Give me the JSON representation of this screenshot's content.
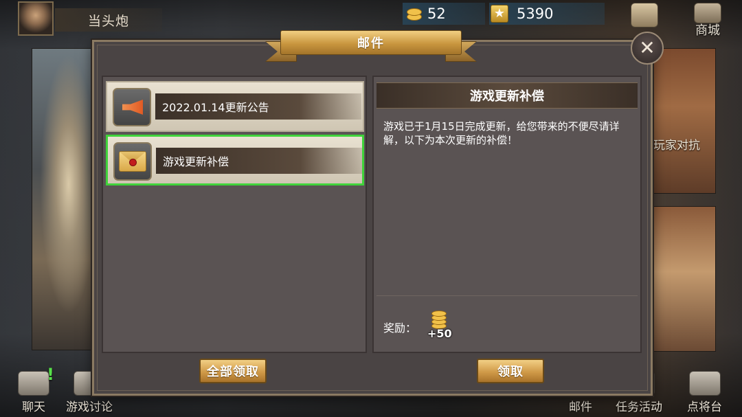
{
  "player": {
    "name": "当头炮"
  },
  "currency": {
    "gold": "52",
    "stars": "5390"
  },
  "top_nav": {
    "shop_label": "商城"
  },
  "background": {
    "right_card_label": "玩家对抗"
  },
  "dialog": {
    "title": "邮件",
    "close_symbol": "✕",
    "mails": [
      {
        "subject": "2022.01.14更新公告",
        "icon": "speaker-icon"
      },
      {
        "subject": "游戏更新补偿",
        "icon": "envelope-icon"
      }
    ],
    "detail": {
      "title": "游戏更新补偿",
      "body": "游戏已于1月15日完成更新，给您带来的不便尽请详解，以下为本次更新的补偿！",
      "reward_label": "奖励：",
      "reward_amount": "+50"
    },
    "claim_all_label": "全部领取",
    "claim_label": "领取"
  },
  "bottom_nav": {
    "chat": "聊天",
    "forum": "游戏讨论",
    "mail": "邮件",
    "tasks": "任务活动",
    "generals": "点将台"
  }
}
